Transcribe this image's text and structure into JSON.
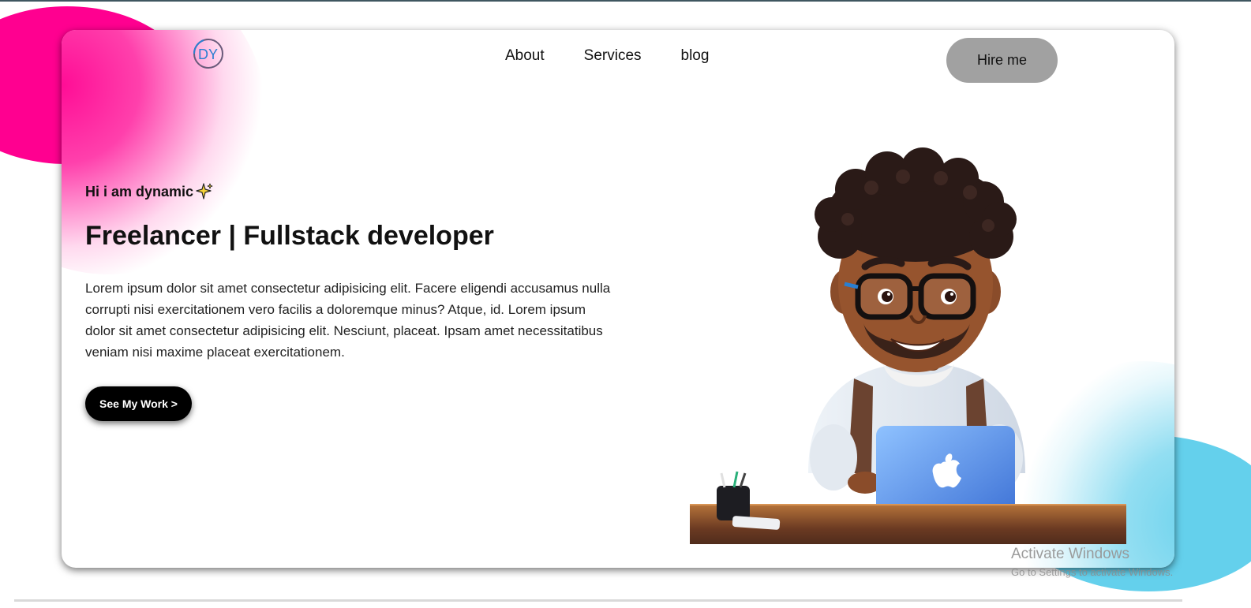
{
  "nav": {
    "items": [
      {
        "label": "About"
      },
      {
        "label": "Services"
      },
      {
        "label": "blog"
      }
    ],
    "cta_label": "Hire me"
  },
  "logo": {
    "text": "DY"
  },
  "hero": {
    "greeting": "Hi i am dynamic",
    "greeting_icon": "sparkles-icon",
    "headline": "Freelancer | Fullstack developer",
    "description": "Lorem ipsum dolor sit amet consectetur adipisicing elit. Facere eligendi accusamus nulla corrupti nisi exercitationem vero facilis a doloremque minus? Atque, id. Lorem ipsum dolor sit amet consectetur adipisicing elit. Nesciunt, placeat. Ipsam amet necessitatibus veniam nisi maxime placeat exercitationem.",
    "button_label": "See My Work >",
    "illustration": "developer-at-laptop-illustration"
  },
  "watermark": {
    "title": "Activate Windows",
    "subtitle": "Go to Settings to activate Windows."
  },
  "colors": {
    "pink_blob": "#ff0090",
    "blue_blob": "#64d0ec",
    "hire_button": "#a1a1a1",
    "work_button": "#000000"
  }
}
